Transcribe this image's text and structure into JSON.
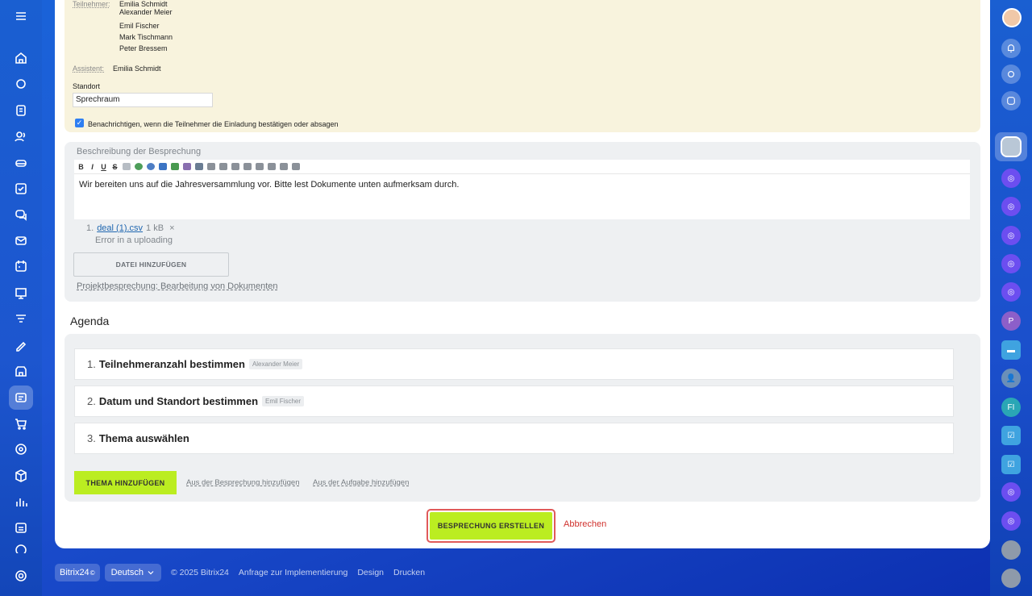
{
  "participants": {
    "label": "Teilnehmer:",
    "names": [
      "Emilia Schmidt",
      "Alexander Meier",
      "Emil Fischer",
      "Mark Tischmann",
      "Peter Bressem"
    ]
  },
  "assistant": {
    "label": "Assistent:",
    "name": "Emilia Schmidt"
  },
  "location": {
    "label": "Standort",
    "value": "Sprechraum"
  },
  "notify": {
    "label": "Benachrichtigen, wenn die Teilnehmer die Einladung bestätigen oder absagen",
    "checked": true
  },
  "description": {
    "label": "Beschreibung der Besprechung",
    "toolbar": [
      "B",
      "I",
      "U",
      "S"
    ],
    "text": "Wir bereiten uns auf die Jahresversammlung vor. Bitte lest Dokumente unten aufmerksam durch."
  },
  "file": {
    "index": "1.",
    "name": "deal (1).csv",
    "size": "1 kB",
    "remove": "×",
    "error": "Error in a uploading",
    "add_button": "DATEI HINZUFÜGEN"
  },
  "project_link": "Projektbesprechung: Bearbeitung von Dokumenten",
  "agenda": {
    "heading": "Agenda",
    "items": [
      {
        "num": "1.",
        "title": "Teilnehmeranzahl bestimmen",
        "tag": "Alexander Meier"
      },
      {
        "num": "2.",
        "title": "Datum und Standort bestimmen",
        "tag": "Emil Fischer"
      },
      {
        "num": "3.",
        "title": "Thema auswählen",
        "tag": ""
      }
    ],
    "add_button": "THEMA HINZUFÜGEN",
    "link_meeting": "Aus der Besprechung hinzufügen",
    "link_task": "Aus der Aufgabe hinzufügen"
  },
  "actions": {
    "create": "BESPRECHUNG ERSTELLEN",
    "cancel": "Abbrechen"
  },
  "footer": {
    "brand": "Bitrix24",
    "brand_sup": "©",
    "language": "Deutsch",
    "copyright": "© 2025 Bitrix24",
    "links": [
      "Anfrage zur Implementierung",
      "Design",
      "Drucken"
    ]
  },
  "right_sidebar": {
    "initial_p": "P",
    "initial_fi": "FI"
  },
  "colors": {
    "accent_green": "#bbed21",
    "link_blue": "#2067b0",
    "cancel_red": "#d0312d",
    "highlight_red": "#e05a5a"
  }
}
